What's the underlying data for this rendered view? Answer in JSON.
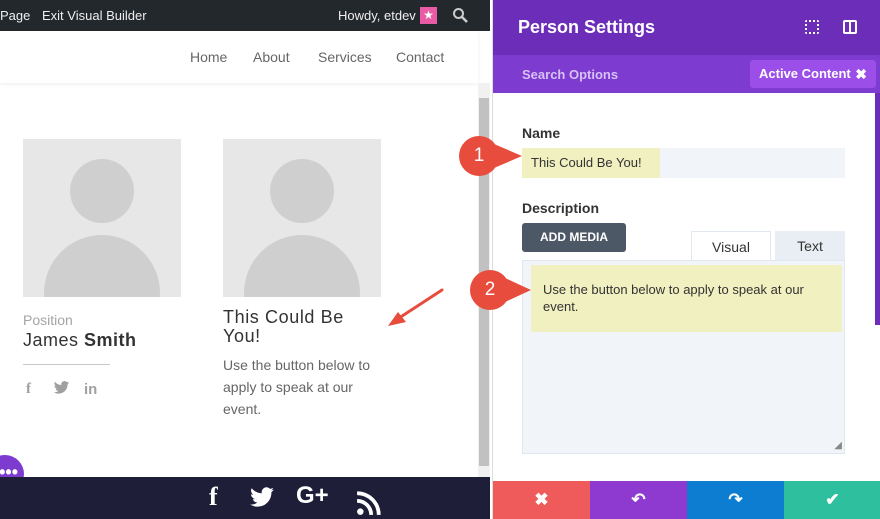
{
  "admin_bar": {
    "page_link": "Page",
    "exit_link": "Exit Visual Builder",
    "howdy": "Howdy, etdev",
    "avatar_glyph": "★",
    "search_glyph": "⚲"
  },
  "nav": {
    "items": [
      "Home",
      "About",
      "Services",
      "Contact"
    ]
  },
  "person1": {
    "position": "Position",
    "first_name": "James ",
    "last_name": "Smith",
    "social": [
      "f",
      "t",
      "in"
    ]
  },
  "person2": {
    "name": "This Could Be You!",
    "description": "Use the button below to apply to speak at our event."
  },
  "builder_dot": "•••",
  "footer_icons": [
    "f",
    "t",
    "G+",
    "rss"
  ],
  "panel": {
    "title": "Person Settings",
    "search_options": "Search Options",
    "active_content": "Active Content",
    "active_close": "✖",
    "name_label": "Name",
    "name_value": "This Could Be You!",
    "description_label": "Description",
    "add_media": "ADD MEDIA",
    "tab_visual": "Visual",
    "tab_text": "Text",
    "description_value": "Use the button below to apply to speak at our event."
  },
  "markers": [
    "1",
    "2"
  ],
  "actions": {
    "cancel": "✖",
    "undo": "↶",
    "redo": "↷",
    "save": "✔"
  },
  "colors": {
    "panel_header": "#6c2eb9",
    "panel_subheader": "#7e3bd0",
    "active_badge": "#9b4ee8",
    "highlight": "#f0f0c0",
    "marker_red": "#e74c3c",
    "cancel": "#ef5b5b",
    "undo": "#8e3ad0",
    "redo": "#0c7dd1",
    "save": "#2ebf9e"
  }
}
